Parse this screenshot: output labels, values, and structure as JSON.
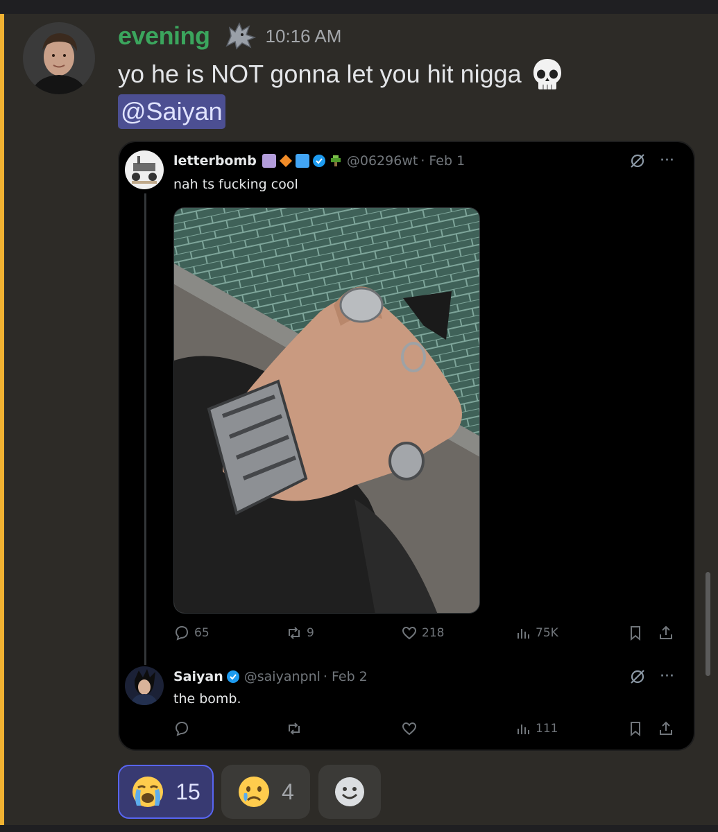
{
  "message": {
    "author": "evening",
    "timestamp": "10:16 AM",
    "text": "yo he is NOT gonna let you hit nigga",
    "mention": "@Saiyan",
    "author_color": "#3ba55d"
  },
  "embed": {
    "tweets": [
      {
        "name": "letterbomb",
        "handle": "@06296wt",
        "date": "· Feb 1",
        "text": "nah ts fucking cool",
        "stats": {
          "replies": "65",
          "retweets": "9",
          "likes": "218",
          "views": "75K"
        }
      },
      {
        "name": "Saiyan",
        "handle": "@saiyanpnl",
        "date": "· Feb 2",
        "text": "the bomb.",
        "stats": {
          "views": "111"
        }
      }
    ],
    "more_label": "···"
  },
  "reactions": [
    {
      "emoji": "loudly-crying-face",
      "count": "15",
      "selected": true
    },
    {
      "emoji": "crying-face",
      "count": "4",
      "selected": false
    }
  ],
  "colors": {
    "accent": "#5865f2",
    "verified": "#1d9bf0",
    "mention_bg": "#4c4f92"
  }
}
